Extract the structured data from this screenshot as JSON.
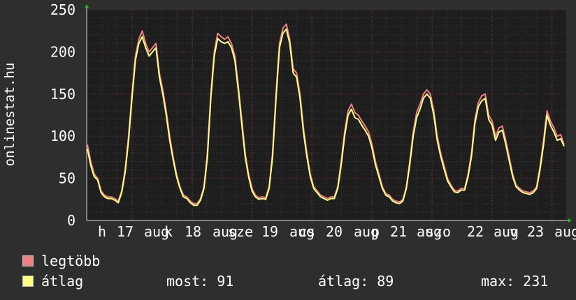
{
  "chart_data": {
    "type": "line",
    "ylabel": "onlinestat.hu",
    "ylim": [
      0,
      250
    ],
    "yticks": [
      0,
      50,
      100,
      150,
      200,
      250
    ],
    "xticks": [
      "h",
      "17",
      "aug",
      "k",
      "18",
      "aug",
      "sze",
      "19",
      "aug",
      "cs",
      "20",
      "aug",
      "p",
      "21",
      "aug",
      "szo",
      "22",
      "aug",
      "v",
      "23",
      "aug"
    ],
    "grid": true,
    "series": [
      {
        "name": "legtöbb",
        "color": "#f08080",
        "values": [
          90,
          70,
          55,
          50,
          35,
          30,
          28,
          28,
          26,
          23,
          35,
          60,
          100,
          150,
          195,
          215,
          225,
          210,
          200,
          205,
          210,
          175,
          155,
          130,
          100,
          75,
          55,
          40,
          30,
          28,
          23,
          20,
          20,
          26,
          40,
          80,
          150,
          200,
          222,
          218,
          215,
          218,
          210,
          195,
          160,
          120,
          80,
          55,
          38,
          30,
          27,
          28,
          27,
          40,
          80,
          150,
          210,
          228,
          233,
          215,
          180,
          175,
          150,
          110,
          80,
          55,
          40,
          35,
          30,
          28,
          26,
          28,
          28,
          40,
          70,
          105,
          130,
          138,
          128,
          125,
          118,
          112,
          105,
          90,
          70,
          55,
          40,
          32,
          30,
          25,
          23,
          22,
          25,
          40,
          70,
          105,
          128,
          138,
          150,
          155,
          150,
          130,
          100,
          80,
          65,
          50,
          42,
          36,
          35,
          38,
          38,
          55,
          80,
          120,
          140,
          148,
          150,
          125,
          118,
          100,
          110,
          112,
          95,
          75,
          55,
          42,
          38,
          35,
          34,
          33,
          35,
          40,
          65,
          95,
          130,
          118,
          110,
          100,
          102,
          90
        ]
      },
      {
        "name": "átlag",
        "color": "#ffff80",
        "values": [
          85,
          65,
          52,
          48,
          33,
          28,
          26,
          26,
          24,
          21,
          33,
          57,
          95,
          145,
          190,
          210,
          218,
          205,
          195,
          200,
          205,
          170,
          150,
          125,
          95,
          72,
          52,
          38,
          28,
          26,
          21,
          18,
          18,
          24,
          38,
          75,
          145,
          195,
          216,
          212,
          210,
          212,
          205,
          190,
          155,
          115,
          76,
          52,
          35,
          28,
          25,
          26,
          25,
          38,
          75,
          145,
          205,
          222,
          227,
          210,
          175,
          170,
          145,
          105,
          76,
          52,
          38,
          33,
          28,
          26,
          24,
          26,
          26,
          38,
          66,
          100,
          125,
          132,
          122,
          120,
          113,
          107,
          100,
          86,
          66,
          52,
          38,
          30,
          28,
          23,
          21,
          20,
          23,
          38,
          66,
          100,
          122,
          132,
          145,
          150,
          145,
          125,
          95,
          76,
          61,
          47,
          40,
          34,
          33,
          36,
          36,
          52,
          76,
          115,
          135,
          142,
          145,
          120,
          113,
          95,
          105,
          107,
          90,
          71,
          52,
          40,
          36,
          33,
          32,
          31,
          33,
          38,
          61,
          90,
          125,
          113,
          105,
          95,
          97,
          88
        ]
      }
    ]
  },
  "legend": [
    {
      "label": "legtöbb",
      "color": "#f08080"
    },
    {
      "label": "átlag",
      "color": "#ffff80"
    }
  ],
  "stats": {
    "most_label": "most:",
    "most_value": "91",
    "atlag_label": "átlag:",
    "atlag_value": "89",
    "max_label": "max:",
    "max_value": "231"
  }
}
